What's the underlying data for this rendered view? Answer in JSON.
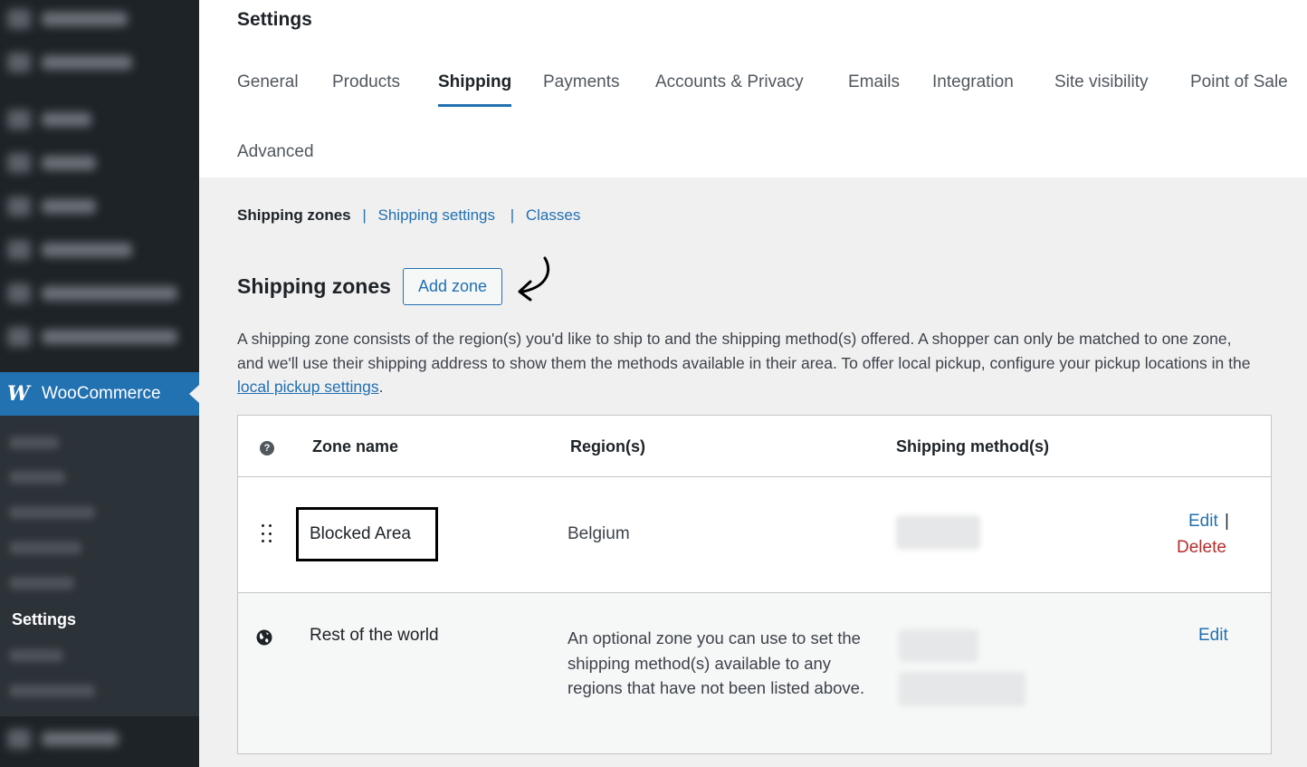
{
  "sidebar": {
    "woocommerce_label": "WooCommerce",
    "woo_logo": "W",
    "settings_label": "Settings"
  },
  "header": {
    "title": "Settings",
    "tabs": [
      {
        "label": "General"
      },
      {
        "label": "Products"
      },
      {
        "label": "Shipping",
        "active": true
      },
      {
        "label": "Payments"
      },
      {
        "label": "Accounts & Privacy"
      },
      {
        "label": "Emails"
      },
      {
        "label": "Integration"
      },
      {
        "label": "Site visibility"
      },
      {
        "label": "Point of Sale"
      },
      {
        "label": "Advanced"
      }
    ]
  },
  "subnav": {
    "current": "Shipping zones",
    "sep": "|",
    "settings": "Shipping settings",
    "classes": "Classes"
  },
  "zones_section": {
    "title": "Shipping zones",
    "add_button": "Add zone",
    "desc_text": "A shipping zone consists of the region(s) you'd like to ship to and the shipping method(s) offered. A shopper can only be matched to one zone, and we'll use their shipping address to show them the methods available in their area. To offer local pickup, configure your pickup locations in the ",
    "desc_link": "local pickup settings",
    "desc_end": "."
  },
  "table": {
    "help_glyph": "?",
    "headers": {
      "zone": "Zone name",
      "regions": "Region(s)",
      "methods": "Shipping method(s)"
    },
    "rows": [
      {
        "name": "Blocked Area",
        "region": "Belgium",
        "edit": "Edit",
        "pipe": "|",
        "delete": "Delete"
      },
      {
        "name": "Rest of the world",
        "region": "An optional zone you can use to set the shipping method(s) available to any regions that have not been listed above.",
        "edit": "Edit"
      }
    ]
  },
  "colors": {
    "accent": "#2271b1",
    "sidebar": "#1d2327",
    "danger": "#b32d2e"
  },
  "icons": [
    "woocommerce-logo-icon",
    "help-icon",
    "drag-handle-icon",
    "globe-icon",
    "curved-arrow-icon"
  ]
}
